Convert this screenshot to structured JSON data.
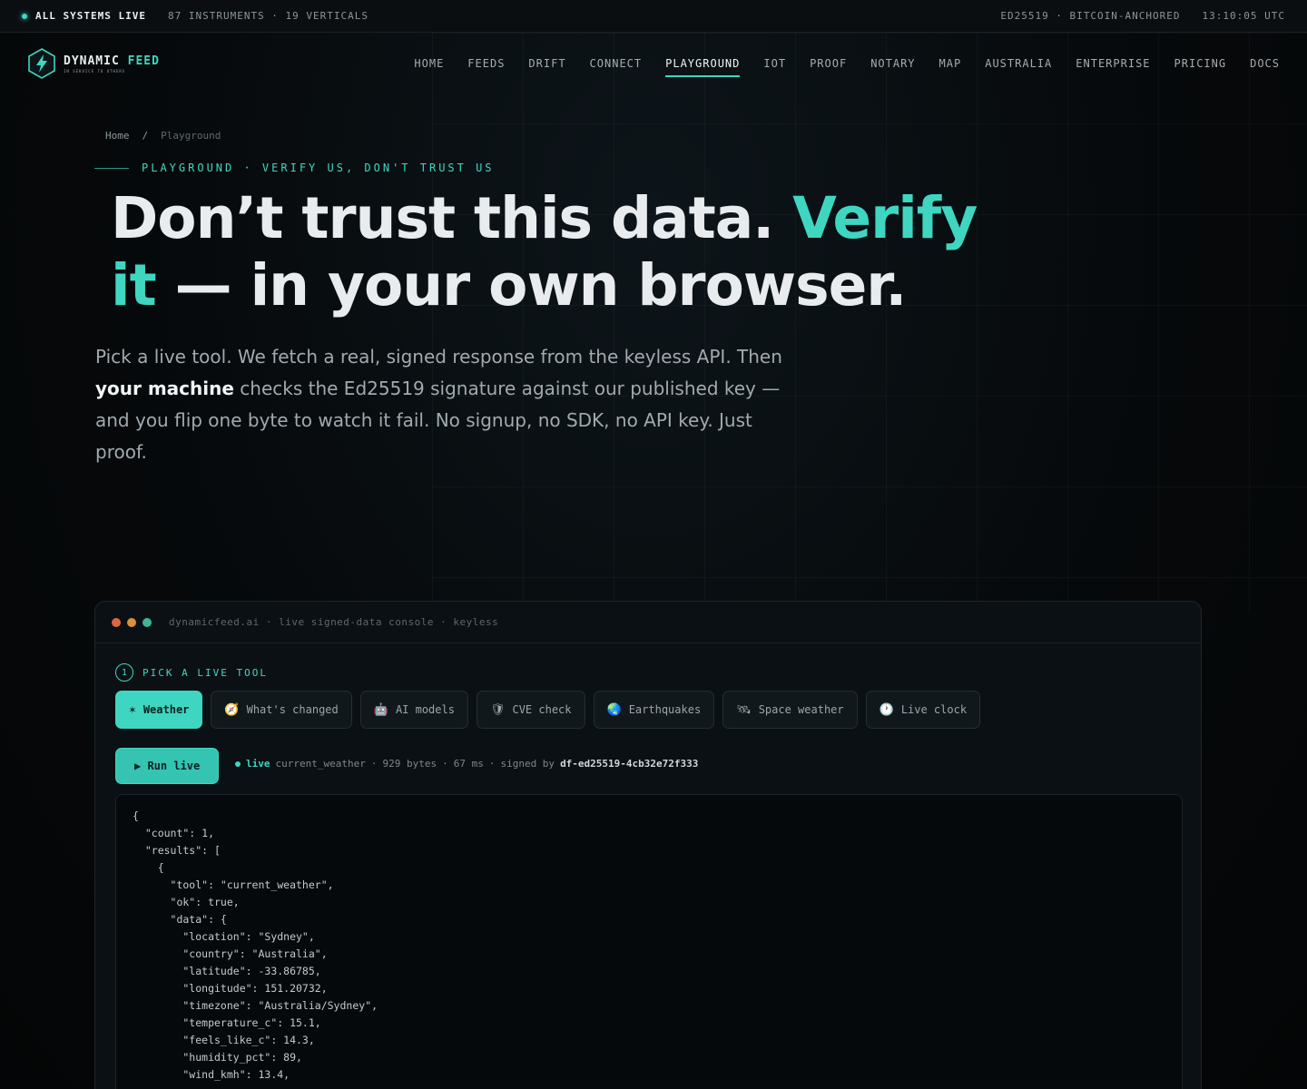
{
  "status": {
    "live": "ALL SYSTEMS LIVE",
    "counts": "87 INSTRUMENTS · 19 VERTICALS",
    "anchor": "ED25519 · BITCOIN-ANCHORED",
    "time": "13:10:05 UTC"
  },
  "brand": {
    "name_a": "DYNAMIC",
    "name_b": "FEED",
    "tagline": "IN SERVICE TO OTHERS"
  },
  "nav": [
    "HOME",
    "FEEDS",
    "DRIFT",
    "CONNECT",
    "PLAYGROUND",
    "IOT",
    "PROOF",
    "NOTARY",
    "MAP",
    "AUSTRALIA",
    "ENTERPRISE",
    "PRICING",
    "DOCS"
  ],
  "breadcrumb": {
    "home": "Home",
    "sep": "/",
    "current": "Playground"
  },
  "eyebrow": "PLAYGROUND · VERIFY US, DON'T TRUST US",
  "hero": {
    "part1": "Don’t trust this data. ",
    "accent1": "Verify",
    "accent2": "it",
    "part2": " — in your own browser."
  },
  "lede": {
    "a": "Pick a live tool. We fetch a real, signed response from the keyless API. Then ",
    "bold": "your machine",
    "b": " checks the Ed25519 signature against our published key — and you flip one byte to watch it fail. No signup, no SDK, no API key. Just proof."
  },
  "console": {
    "title": "dynamicfeed.ai · live signed-data console · keyless",
    "colors": {
      "red": "#e0663f",
      "amber": "#d8913a",
      "green": "#3fb59a"
    },
    "step_num": "1",
    "step_label": "PICK A LIVE TOOL",
    "tools": [
      {
        "icon": "✶",
        "label": "Weather"
      },
      {
        "icon": "🧭",
        "label": "What's changed"
      },
      {
        "icon": "🤖",
        "label": "AI models"
      },
      {
        "icon": "🛡",
        "label": "CVE check"
      },
      {
        "icon": "🌏",
        "label": "Earthquakes"
      },
      {
        "icon": "🛰",
        "label": "Space weather"
      },
      {
        "icon": "🕐",
        "label": "Live clock"
      }
    ],
    "run_label": "▶ Run live",
    "meta": {
      "live": "live",
      "tool": "current_weather",
      "bytes": "929 bytes",
      "ms": "67 ms",
      "signed_by": "signed by",
      "key": "df-ed25519-4cb32e72f333"
    },
    "json": "{\n  \"count\": 1,\n  \"results\": [\n    {\n      \"tool\": \"current_weather\",\n      \"ok\": true,\n      \"data\": {\n        \"location\": \"Sydney\",\n        \"country\": \"Australia\",\n        \"latitude\": -33.86785,\n        \"longitude\": 151.20732,\n        \"timezone\": \"Australia/Sydney\",\n        \"temperature_c\": 15.1,\n        \"feels_like_c\": 14.3,\n        \"humidity_pct\": 89,\n        \"wind_kmh\": 13.4,"
  },
  "accent": "#3fd6c1"
}
